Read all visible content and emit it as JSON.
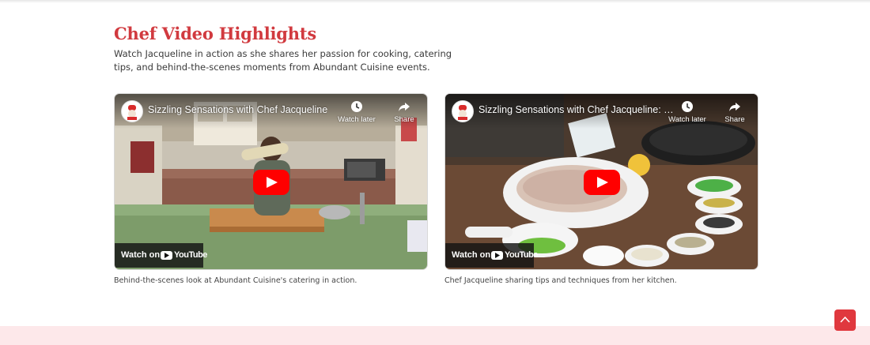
{
  "section": {
    "title": "Chef Video Highlights",
    "description": "Watch Jacqueline in action as she shares her passion for cooking, catering tips, and behind-the-scenes moments from Abundant Cuisine events."
  },
  "videos": [
    {
      "title": "Sizzling Sensations with Chef Jacqueline",
      "watch_later_label": "Watch later",
      "share_label": "Share",
      "watch_on_label": "Watch on",
      "youtube_label": "YouTube",
      "caption": "Behind-the-scenes look at Abundant Cuisine's catering in action."
    },
    {
      "title": "Sizzling Sensations with Chef Jacqueline: St...",
      "watch_later_label": "Watch later",
      "share_label": "Share",
      "watch_on_label": "Watch on",
      "youtube_label": "YouTube",
      "caption": "Chef Jacqueline sharing tips and techniques from her kitchen."
    }
  ],
  "icons": {
    "scroll_top": "chevron-up-icon",
    "play": "play-icon",
    "watch_later": "clock-icon",
    "share": "share-arrow-icon"
  },
  "colors": {
    "accent": "#d13a3f",
    "youtube_red": "#ff0000",
    "footer_band": "#fde8ea",
    "scroll_button": "#e0383e"
  }
}
